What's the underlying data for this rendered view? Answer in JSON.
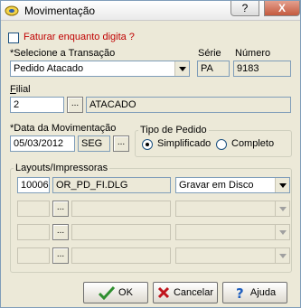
{
  "window": {
    "title": "Movimentação",
    "help_label": "?",
    "close_label": "X"
  },
  "faturar": {
    "label": "Faturar enquanto digita ?",
    "checked": false
  },
  "transacao": {
    "label": "*Selecione a Transação",
    "value": "Pedido Atacado",
    "serie_label": "Série",
    "serie_value": "PA",
    "numero_label": "Número",
    "numero_value": "9183"
  },
  "filial": {
    "label": "Filial",
    "code": "2",
    "lookup_label": "...",
    "name": "ATACADO"
  },
  "data_mov": {
    "label": "*Data da Movimentação",
    "date": "05/03/2012",
    "weekday": "SEG",
    "lookup_label": "..."
  },
  "tipo_pedido": {
    "label": "Tipo de Pedido",
    "options": [
      "Simplificado",
      "Completo"
    ],
    "selected": "Simplificado"
  },
  "layouts": {
    "label": "Layouts/Impressoras",
    "rows": [
      {
        "code": "10006",
        "file": "OR_PD_FI.DLG",
        "action": "Gravar em Disco"
      },
      {
        "code": "",
        "file": "",
        "action": ""
      },
      {
        "code": "",
        "file": "",
        "action": ""
      },
      {
        "code": "",
        "file": "",
        "action": ""
      }
    ],
    "lookup_label": "..."
  },
  "buttons": {
    "ok": "OK",
    "cancel": "Cancelar",
    "help": "Ajuda"
  },
  "colors": {
    "required_red": "#c00000",
    "ok_green": "#2f8f2f",
    "cancel_red": "#c0141c",
    "help_blue": "#1f5fbf"
  }
}
